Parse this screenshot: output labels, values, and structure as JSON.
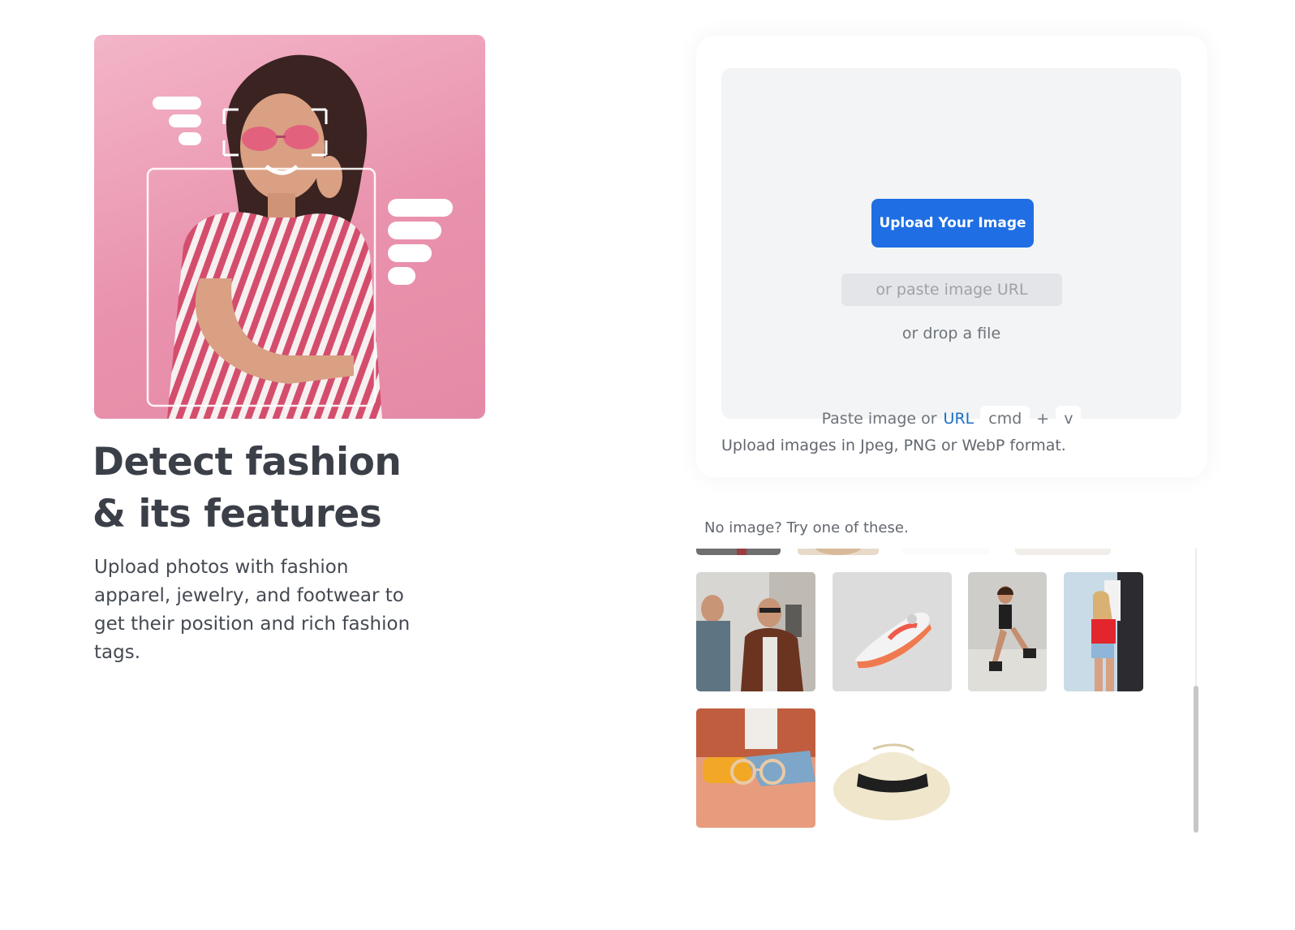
{
  "left": {
    "headline_line1": "Detect fashion",
    "headline_line2": "& its features",
    "description": "Upload photos with fashion apparel, jewelry, and footwear to get their position and rich fashion tags."
  },
  "upload": {
    "button_label": "Upload Your Image",
    "url_placeholder": "or paste image URL",
    "drop_text": "or drop a file",
    "paste_prefix": "Paste image or",
    "paste_url_link": "URL",
    "key_cmd": "cmd",
    "key_plus": "+",
    "key_v": "v",
    "format_note": "Upload images in Jpeg, PNG or WebP format."
  },
  "samples": {
    "title": "No image? Try one of these.",
    "items": [
      "sample-partial-1",
      "sample-partial-2",
      "sample-partial-3",
      "sample-partial-4",
      "sample-street-men",
      "sample-sneaker",
      "sample-skater-girl",
      "sample-red-top",
      "sample-sunglasses",
      "sample-straw-hat"
    ]
  },
  "colors": {
    "primary": "#1f6ee3",
    "link": "#1a6fc4",
    "hero_pink": "#e992ad",
    "dropzone_bg": "#f2f4f5"
  }
}
